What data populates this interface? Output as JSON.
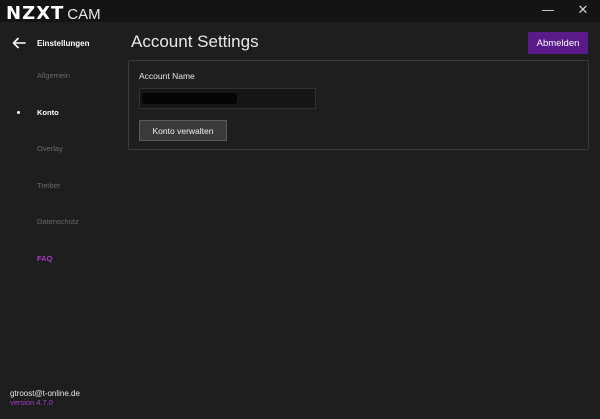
{
  "app": {
    "brand_primary": "NZXT",
    "brand_secondary": "CAM"
  },
  "window_controls": {
    "minimize": "—",
    "close": "✕"
  },
  "sidebar": {
    "back_label": "Einstellungen",
    "items": [
      {
        "label": "Allgemein",
        "state": "inactive"
      },
      {
        "label": "Konto",
        "state": "active"
      },
      {
        "label": "Overlay",
        "state": "inactive"
      },
      {
        "label": "Treiber",
        "state": "inactive"
      },
      {
        "label": "Datenschutz",
        "state": "inactive"
      },
      {
        "label": "FAQ",
        "state": "link"
      }
    ],
    "email": "gtroost@t-online.de",
    "version": "version 4.7.0"
  },
  "main": {
    "title": "Account Settings",
    "logout_label": "Abmelden",
    "account_name_label": "Account Name",
    "account_name_value": "",
    "manage_label": "Konto verwalten"
  },
  "colors": {
    "accent_purple": "#5a1a8a",
    "link_purple": "#a43dc8",
    "background": "#1e1e1f",
    "titlebar": "#141414"
  },
  "icons": {
    "back": "arrow-left-icon",
    "minimize": "minimize-icon",
    "close": "close-icon"
  }
}
